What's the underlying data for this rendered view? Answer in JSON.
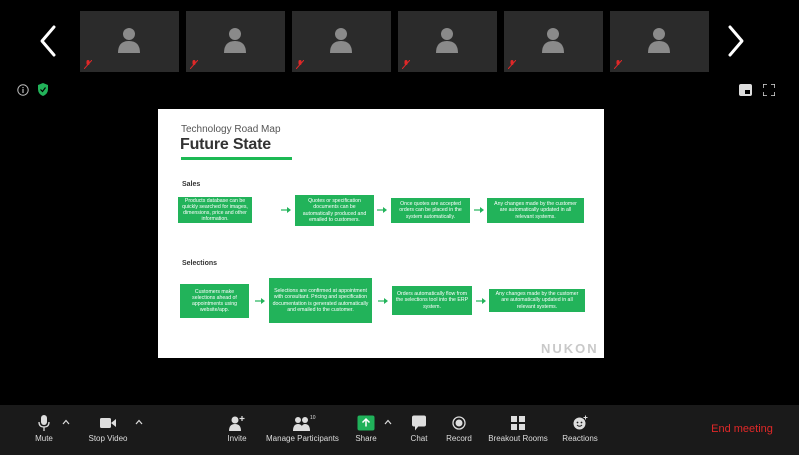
{
  "participants": [
    {
      "muted": true
    },
    {
      "muted": true
    },
    {
      "muted": true
    },
    {
      "muted": true
    },
    {
      "muted": true
    },
    {
      "muted": true
    }
  ],
  "slide": {
    "subtitle": "Technology Road Map",
    "title": "Future State",
    "sections": [
      {
        "label": "Sales",
        "steps": [
          "Products database can be quickly searched for images, dimensions, price and other information.",
          "Quotes or specification documents can be automatically produced and emailed to customers.",
          "Once quotes are accepted orders can be placed in the system automatically.",
          "Any changes made by the customer are automatically updated in all relevant systems."
        ]
      },
      {
        "label": "Selections",
        "steps": [
          "Customers make selections ahead of appointments using website/app.",
          "Selections are confirmed at appointment with consultant. Pricing and specification documentation is generated automatically and emailed to the customer.",
          "Orders automatically flow from the selections tool into the ERP system.",
          "Any changes made by the customer are automatically updated in all relevant systems."
        ]
      }
    ],
    "logo": "NUKON"
  },
  "toolbar": {
    "mute": "Mute",
    "stop_video": "Stop Video",
    "invite": "Invite",
    "manage_participants": "Manage Participants",
    "participant_count": "10",
    "share": "Share",
    "chat": "Chat",
    "record": "Record",
    "breakout_rooms": "Breakout Rooms",
    "reactions": "Reactions",
    "end_meeting": "End meeting"
  },
  "colors": {
    "accent_green": "#22b35a",
    "end_red": "#e02828",
    "share_green": "#20b15a"
  }
}
